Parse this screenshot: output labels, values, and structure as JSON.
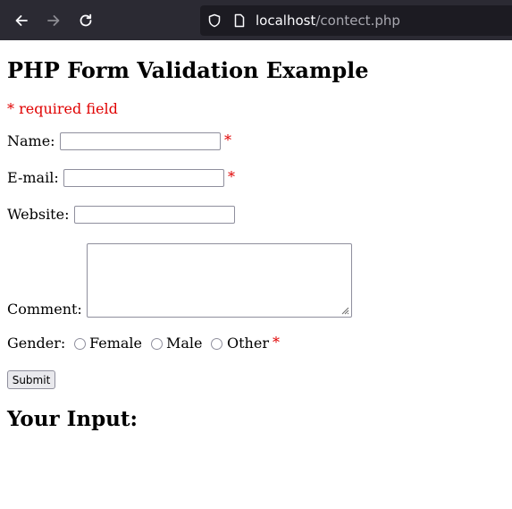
{
  "browser": {
    "url_host": "localhost",
    "url_path": "/contect.php"
  },
  "page": {
    "title": "PHP Form Validation Example",
    "required_note": "* required field",
    "name_label": "Name:",
    "email_label": "E-mail:",
    "website_label": "Website:",
    "comment_label": "Comment:",
    "gender_label": "Gender:",
    "required_marker": "*",
    "name_value": "",
    "email_value": "",
    "website_value": "",
    "comment_value": "",
    "gender_options": [
      "Female",
      "Male",
      "Other"
    ],
    "submit_label": "Submit",
    "output_heading": "Your Input:"
  }
}
